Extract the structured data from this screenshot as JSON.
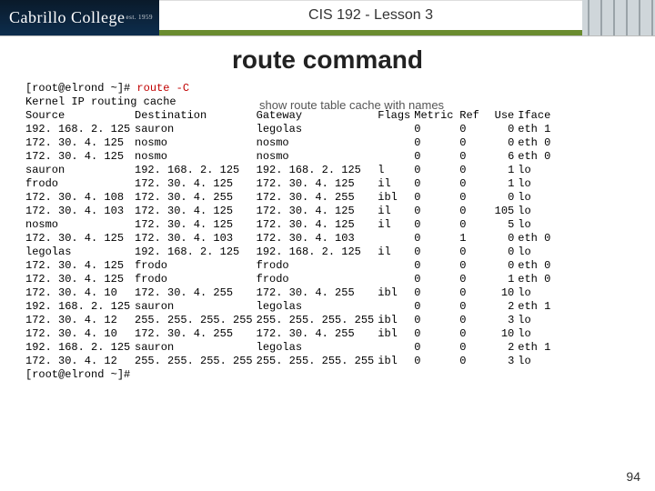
{
  "banner": {
    "logo_text": "Cabrillo College",
    "est1": "est.",
    "est2": "1959",
    "course_title": "CIS 192 - Lesson 3"
  },
  "page_title": "route command",
  "annotation": "show route table cache with names",
  "prompt_prefix": "[root@elrond ~]# ",
  "command": "route -C",
  "cache_header": "Kernel IP routing cache",
  "prompt_suffix": "[root@elrond ~]#",
  "columns": [
    "Source",
    "Destination",
    "Gateway",
    "Flags",
    "Metric",
    "Ref",
    "Use",
    "Iface"
  ],
  "rows": [
    {
      "src": "192. 168. 2. 125",
      "dst": "sauron",
      "gw": "legolas",
      "flags": "",
      "metric": "0",
      "ref": "0",
      "use": "0",
      "iface": "eth 1"
    },
    {
      "src": "172. 30. 4. 125",
      "dst": "nosmo",
      "gw": "nosmo",
      "flags": "",
      "metric": "0",
      "ref": "0",
      "use": "0",
      "iface": "eth 0"
    },
    {
      "src": "172. 30. 4. 125",
      "dst": "nosmo",
      "gw": "nosmo",
      "flags": "",
      "metric": "0",
      "ref": "0",
      "use": "6",
      "iface": "eth 0"
    },
    {
      "src": "sauron",
      "dst": "192. 168. 2. 125",
      "gw": "192. 168. 2. 125",
      "flags": "l",
      "metric": "0",
      "ref": "0",
      "use": "1",
      "iface": "lo"
    },
    {
      "src": "frodo",
      "dst": "172. 30. 4. 125",
      "gw": "172. 30. 4. 125",
      "flags": "il",
      "metric": "0",
      "ref": "0",
      "use": "1",
      "iface": "lo"
    },
    {
      "src": "172. 30. 4. 108",
      "dst": "172. 30. 4. 255",
      "gw": "172. 30. 4. 255",
      "flags": "ibl",
      "metric": "0",
      "ref": "0",
      "use": "0",
      "iface": "lo"
    },
    {
      "src": "172. 30. 4. 103",
      "dst": "172. 30. 4. 125",
      "gw": "172. 30. 4. 125",
      "flags": "il",
      "metric": "0",
      "ref": "0",
      "use": "105",
      "iface": "lo"
    },
    {
      "src": "nosmo",
      "dst": "172. 30. 4. 125",
      "gw": "172. 30. 4. 125",
      "flags": "il",
      "metric": "0",
      "ref": "0",
      "use": "5",
      "iface": "lo"
    },
    {
      "src": "172. 30. 4. 125",
      "dst": "172. 30. 4. 103",
      "gw": "172. 30. 4. 103",
      "flags": "",
      "metric": "0",
      "ref": "1",
      "use": "0",
      "iface": "eth 0"
    },
    {
      "src": "legolas",
      "dst": "192. 168. 2. 125",
      "gw": "192. 168. 2. 125",
      "flags": "il",
      "metric": "0",
      "ref": "0",
      "use": "0",
      "iface": "lo"
    },
    {
      "src": "172. 30. 4. 125",
      "dst": "frodo",
      "gw": "frodo",
      "flags": "",
      "metric": "0",
      "ref": "0",
      "use": "0",
      "iface": "eth 0"
    },
    {
      "src": "172. 30. 4. 125",
      "dst": "frodo",
      "gw": "frodo",
      "flags": "",
      "metric": "0",
      "ref": "0",
      "use": "1",
      "iface": "eth 0"
    },
    {
      "src": "172. 30. 4. 10",
      "dst": "172. 30. 4. 255",
      "gw": "172. 30. 4. 255",
      "flags": "ibl",
      "metric": "0",
      "ref": "0",
      "use": "10",
      "iface": "lo"
    },
    {
      "src": "192. 168. 2. 125",
      "dst": "sauron",
      "gw": "legolas",
      "flags": "",
      "metric": "0",
      "ref": "0",
      "use": "2",
      "iface": "eth 1"
    },
    {
      "src": "172. 30. 4. 12",
      "dst": "255. 255. 255. 255",
      "gw": "255. 255. 255. 255",
      "flags": "ibl",
      "metric": "0",
      "ref": "0",
      "use": "3",
      "iface": "lo"
    },
    {
      "src": "172. 30. 4. 10",
      "dst": "172. 30. 4. 255",
      "gw": "172. 30. 4. 255",
      "flags": "ibl",
      "metric": "0",
      "ref": "0",
      "use": "10",
      "iface": "lo"
    },
    {
      "src": "192. 168. 2. 125",
      "dst": "sauron",
      "gw": "legolas",
      "flags": "",
      "metric": "0",
      "ref": "0",
      "use": "2",
      "iface": "eth 1"
    },
    {
      "src": "172. 30. 4. 12",
      "dst": "255. 255. 255. 255",
      "gw": "255. 255. 255. 255",
      "flags": "ibl",
      "metric": "0",
      "ref": "0",
      "use": "3",
      "iface": "lo"
    }
  ],
  "page_number": "94"
}
